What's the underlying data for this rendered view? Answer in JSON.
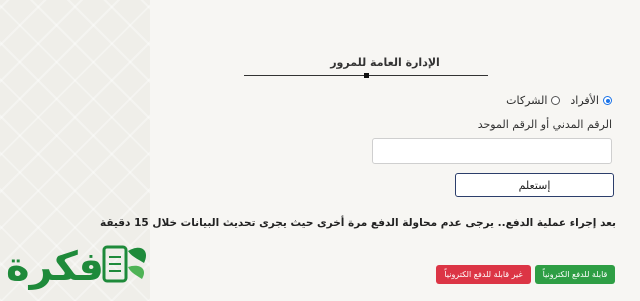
{
  "header": {
    "title": "الإدارة العامة للمرور"
  },
  "radio_group": {
    "options": [
      {
        "label": "الأفراد",
        "checked": true
      },
      {
        "label": "الشركات",
        "checked": false
      }
    ]
  },
  "form": {
    "civil_id_label": "الرقم المدني أو الرقم الموحد",
    "civil_id_value": "",
    "submit_label": "إستعلم"
  },
  "notice": "بعد إجراء عملية الدفع.. يرجى عدم محاولة الدفع مرة أخرى حيث يجرى تحديث البيانات خلال 15 دقيقة",
  "legend": {
    "payable": "قابلة للدفع الكترونياً",
    "not_payable": "غير قابلة للدفع الكترونياً"
  },
  "logo": {
    "text": "فكرة"
  },
  "colors": {
    "accent_blue": "#1a73e8",
    "payable_green": "#2e9e44",
    "not_payable_red": "#dc3545",
    "logo_green": "#1e8a3a"
  }
}
